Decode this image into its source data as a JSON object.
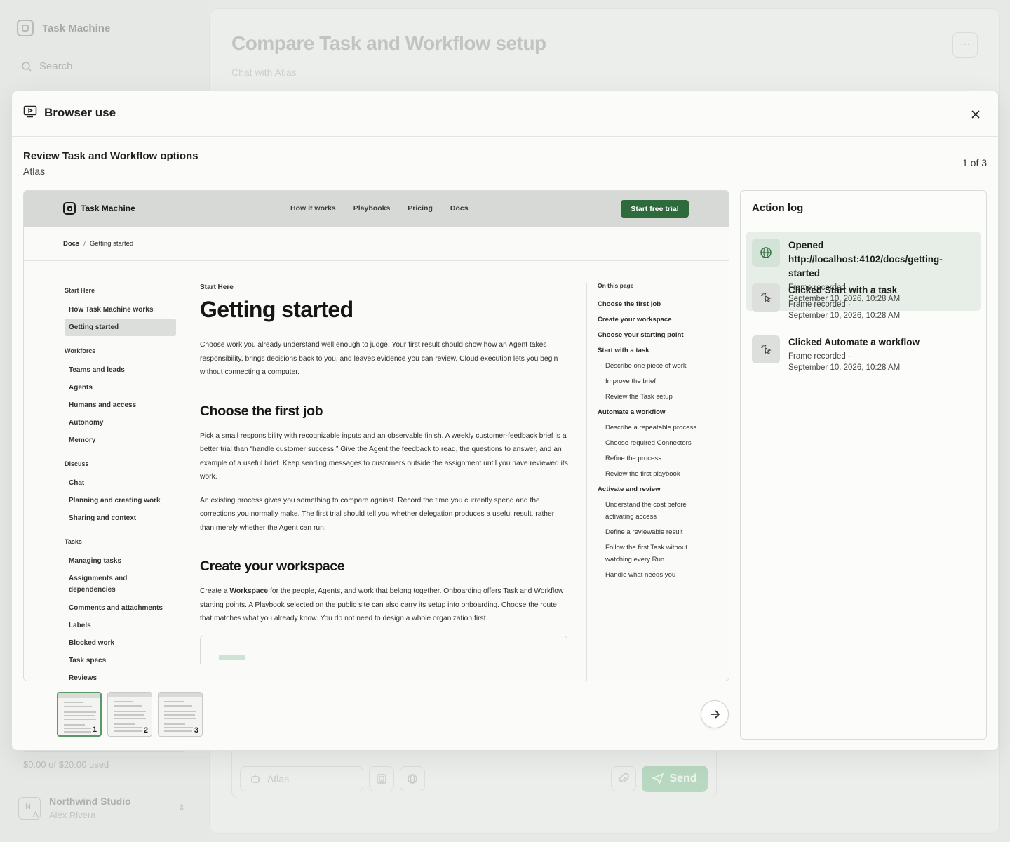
{
  "app": {
    "brand": "Task Machine",
    "search_label": "Search",
    "usage_text": "$0.00 of $20.00 used",
    "org_name": "Northwind Studio",
    "org_initials_top": "N",
    "org_initials_bottom": "A",
    "user_name": "Alex Rivera",
    "page_title": "Compare Task and Workflow setup",
    "page_subtitle": "Chat with Atlas",
    "more_label": "···",
    "composer_agent": "Atlas",
    "send_label": "Send"
  },
  "modal": {
    "title": "Browser use",
    "task_title": "Review Task and Workflow options",
    "agent": "Atlas",
    "counter": "1 of 3"
  },
  "site": {
    "brand": "Task Machine",
    "nav": [
      "How it works",
      "Playbooks",
      "Pricing",
      "Docs"
    ],
    "cta": "Start free trial",
    "breadcrumb": [
      "Docs",
      "Getting started"
    ],
    "breadcrumb_sep": "/",
    "left_nav": [
      {
        "group": "Start Here",
        "items": [
          "How Task Machine works",
          "Getting started"
        ]
      },
      {
        "group": "Workforce",
        "items": [
          "Teams and leads",
          "Agents",
          "Humans and access",
          "Autonomy",
          "Memory"
        ]
      },
      {
        "group": "Discuss",
        "items": [
          "Chat",
          "Planning and creating work",
          "Sharing and context"
        ]
      },
      {
        "group": "Tasks",
        "items": [
          "Managing tasks",
          "Assignments and dependencies",
          "Comments and attachments",
          "Labels",
          "Blocked work",
          "Task specs",
          "Reviews"
        ]
      }
    ],
    "active_item": "Getting started",
    "article": {
      "kicker": "Start Here",
      "title": "Getting started",
      "intro": "Choose work you already understand well enough to judge. Your first result should show how an Agent takes responsibility, brings decisions back to you, and leaves evidence you can review. Cloud execution lets you begin without connecting a computer.",
      "h2_1": "Choose the first job",
      "p1": "Pick a small responsibility with recognizable inputs and an observable finish. A weekly customer-feedback brief is a better trial than “handle customer success.” Give the Agent the feedback to read, the questions to answer, and an example of a useful brief. Keep sending messages to customers outside the assignment until you have reviewed its work.",
      "p2": "An existing process gives you something to compare against. Record the time you currently spend and the corrections you normally make. The first trial should tell you whether delegation produces a useful result, rather than merely whether the Agent can run.",
      "h2_2": "Create your workspace",
      "p3_before": "Create a ",
      "p3_bold": "Workspace",
      "p3_after": " for the people, Agents, and work that belong together. Onboarding offers Task and Workflow starting points. A Playbook selected on the public site can also carry its setup into onboarding. Choose the route that matches what you already know. You do not need to design a whole organization first."
    },
    "toc": {
      "heading": "On this page",
      "items": [
        {
          "level": "h",
          "text": "Choose the first job"
        },
        {
          "level": "h",
          "text": "Create your workspace"
        },
        {
          "level": "h",
          "text": "Choose your starting point"
        },
        {
          "level": "h",
          "text": "Start with a task"
        },
        {
          "level": "s",
          "text": "Describe one piece of work"
        },
        {
          "level": "s",
          "text": "Improve the brief"
        },
        {
          "level": "s",
          "text": "Review the Task setup"
        },
        {
          "level": "h",
          "text": "Automate a workflow"
        },
        {
          "level": "s",
          "text": "Describe a repeatable process"
        },
        {
          "level": "s",
          "text": "Choose required Connectors"
        },
        {
          "level": "s",
          "text": "Refine the process"
        },
        {
          "level": "s",
          "text": "Review the first playbook"
        },
        {
          "level": "h",
          "text": "Activate and review"
        },
        {
          "level": "s",
          "text": "Understand the cost before activating access"
        },
        {
          "level": "s",
          "text": "Define a reviewable result"
        },
        {
          "level": "s",
          "text": "Follow the first Task without watching every Run"
        },
        {
          "level": "s",
          "text": "Handle what needs you"
        }
      ]
    }
  },
  "thumbnails": [
    "1",
    "2",
    "3"
  ],
  "action_log": {
    "title": "Action log",
    "entries": [
      {
        "icon": "globe-icon",
        "title": "Opened http://localhost:4102/docs/getting-started",
        "meta": "Frame recorded  ·",
        "time": "September 10, 2026, 10:28 AM"
      },
      {
        "icon": "cursor-click-icon",
        "title": "Clicked Start with a task",
        "meta": "Frame recorded  ·",
        "time": "September 10, 2026, 10:28 AM"
      },
      {
        "icon": "cursor-click-icon",
        "title": "Clicked Automate a workflow",
        "meta": "Frame recorded  ·",
        "time": "September 10, 2026, 10:28 AM"
      }
    ]
  },
  "colors": {
    "accent": "#2d6b3d",
    "selected_bg": "#e6eee7"
  }
}
